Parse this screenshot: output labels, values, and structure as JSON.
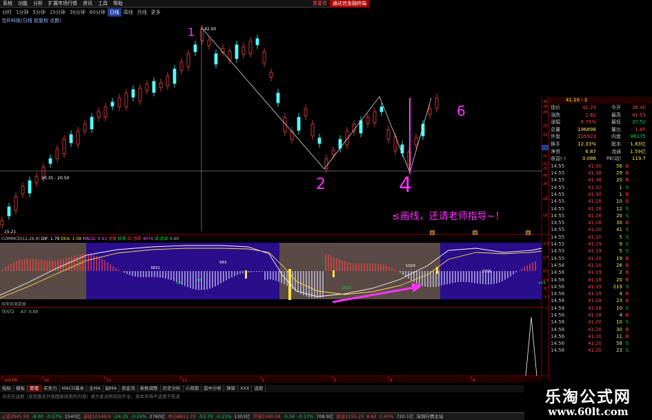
{
  "menu": {
    "items": [
      "系统",
      "功能",
      "分析",
      "扩展市场行情",
      "资讯",
      "工具",
      "帮助"
    ],
    "special": "重要资",
    "brand": "通达信金融终端"
  },
  "periods": {
    "items": [
      "分时",
      "1分钟",
      "5分钟",
      "15分钟",
      "30分钟",
      "60分钟",
      "日线",
      "周线",
      "月线",
      "更多"
    ],
    "active": "日线"
  },
  "stock": {
    "name": "当升科技(日线 前复权 点数)"
  },
  "main_chart": {
    "price_labels": {
      "top": "42.00",
      "mid": "20.35 - 20.50",
      "bottom": "15.21"
    },
    "right_axis": [
      "28.83",
      "28.60",
      "28.37",
      "23.61",
      "23.28",
      "22.46",
      "21.86",
      "21.32",
      "21.00",
      "20.65",
      "20.32",
      "19.55",
      "19.00"
    ],
    "axis_highlight": "22.46",
    "annotations": [
      "1",
      "2",
      "4",
      "6"
    ],
    "note": "≤画线，还请老师指导~！",
    "markers": [
      "跌",
      "涨",
      "跌"
    ]
  },
  "indicator": {
    "title": "COMMCD(12,26,9)",
    "values": [
      {
        "text": "DIF: 1.79",
        "color": "#ffffff"
      },
      {
        "text": "DEA: 1.58",
        "color": "#ffe24a"
      },
      {
        "text": "MACD: 0.41",
        "color": "#ff66ff"
      },
      {
        "text": "顶背",
        "color": "#ff4444"
      },
      {
        "text": "底背",
        "color": "#00d84a"
      },
      {
        "text": "红:顶部",
        "color": "#ff4444"
      },
      {
        "text": "4074",
        "color": "#ff66ff"
      },
      {
        "text": "绿:底部",
        "color": "#00d84a"
      },
      {
        "text": "0.00",
        "color": "#c0c0c0"
      }
    ],
    "labels": [
      "3831",
      "983",
      "285",
      "86",
      "2820",
      "1024",
      "2096",
      "434"
    ],
    "footer": "周期背离数据",
    "axis": [
      "2.00",
      "1.50",
      "0.50",
      "0.00",
      "-0.50",
      "-1.00"
    ]
  },
  "sub_indicator": {
    "title": "TEST2",
    "value": "A7: 0.00"
  },
  "dates": [
    "2015年",
    "10",
    "11",
    "12",
    "1",
    "2",
    "3",
    "4"
  ],
  "quote": {
    "header": "41.10 - 2",
    "rows": [
      {
        "c1": "现价",
        "c2": "41.29",
        "c3": "今开",
        "c4": "38.40",
        "cc2": "red",
        "cc4": "red"
      },
      {
        "c1": "涨跌",
        "c2": "2.61",
        "c3": "最高",
        "c4": "41.53",
        "cc2": "red",
        "cc4": "red"
      },
      {
        "c1": "涨幅",
        "c2": "6.76%",
        "c3": "最低",
        "c4": "37.52",
        "cc2": "red",
        "cc4": "green"
      },
      {
        "c1": "总量",
        "c2": "196898",
        "c3": "量比",
        "c4": "1.85",
        "cc2": "yellow",
        "cc4": "red"
      },
      {
        "c1": "外盘",
        "c2": "105923",
        "c3": "内盘",
        "c4": "86175",
        "cc2": "red",
        "cc4": "green"
      },
      {
        "c1": "换手",
        "c2": "12.33%",
        "c3": "股本",
        "c4": "1.83亿",
        "cc2": "yellow",
        "cc4": "yellow"
      },
      {
        "c1": "净资",
        "c2": "6.87",
        "c3": "流通",
        "c4": "1.59亿",
        "cc2": "yellow",
        "cc4": "yellow"
      },
      {
        "c1": "收益(-)",
        "c2": "0.086",
        "c3": "PE(动)",
        "c4": "119.7",
        "cc2": "yellow",
        "cc4": "yellow"
      }
    ],
    "ticks": [
      {
        "t": "14:55",
        "p": "41.30",
        "v": "56",
        "d": "B"
      },
      {
        "t": "14:55",
        "p": "41.38",
        "v": "29",
        "d": "B"
      },
      {
        "t": "14:55",
        "p": "41.38",
        "v": "20",
        "d": "B"
      },
      {
        "t": "14:55",
        "p": "41.32",
        "v": "1",
        "d": "S"
      },
      {
        "t": "14:55",
        "p": "41.30",
        "v": "1",
        "d": "B"
      },
      {
        "t": "14:55",
        "p": "41.28",
        "v": "10",
        "d": "B"
      },
      {
        "t": "14:55",
        "p": "41.26",
        "v": "12",
        "d": "S"
      },
      {
        "t": "14:55",
        "p": "41.28",
        "v": "20",
        "d": "S"
      },
      {
        "t": "14:55",
        "p": "41.28",
        "v": "30",
        "d": "B"
      },
      {
        "t": "14:55",
        "p": "41.20",
        "v": "41",
        "d": "S"
      },
      {
        "t": "14:55",
        "p": "41.20",
        "v": "5",
        "d": "S"
      },
      {
        "t": "14:55",
        "p": "41.19",
        "v": "9",
        "d": "S"
      },
      {
        "t": "14:55",
        "p": "41.19",
        "v": "5",
        "d": "S"
      },
      {
        "t": "14:55",
        "p": "41.20",
        "v": "19",
        "d": "B"
      },
      {
        "t": "14:56",
        "p": "41.20",
        "v": "26",
        "d": "B"
      },
      {
        "t": "14:56",
        "p": "41.19",
        "v": "2",
        "d": "B"
      },
      {
        "t": "14:56",
        "p": "41.18",
        "v": "20",
        "d": "B"
      },
      {
        "t": "14:56",
        "p": "41.19",
        "v": "219",
        "d": "S"
      },
      {
        "t": "14:56",
        "p": "41.19",
        "v": "4",
        "d": "B"
      },
      {
        "t": "14:56",
        "p": "41.18",
        "v": "23",
        "d": "B"
      },
      {
        "t": "14:56",
        "p": "41.18",
        "v": "10",
        "d": "S"
      },
      {
        "t": "14:56",
        "p": "41.18",
        "v": "4",
        "d": "B"
      },
      {
        "t": "14:56",
        "p": "41.20",
        "v": "10",
        "d": "S"
      },
      {
        "t": "14:56",
        "p": "41.20",
        "v": "30",
        "d": "B"
      },
      {
        "t": "14:56",
        "p": "41.20",
        "v": "11",
        "d": "B"
      },
      {
        "t": "14:56",
        "p": "41.20",
        "v": "58",
        "d": "S"
      },
      {
        "t": "14:56",
        "p": "41.20",
        "v": "23",
        "d": "S"
      }
    ]
  },
  "tabs": {
    "items": [
      "指标",
      "模板",
      "管理",
      "买卖力",
      "MACD基本",
      "主MA",
      "副MA",
      "资金流",
      "参数调整",
      "历史分析",
      "小周期",
      "盘中分析",
      "弹窗",
      "XXX",
      "选股"
    ],
    "active": "管理"
  },
  "infobar": {
    "items": [
      "点击任选框",
      "(该页面无外部国家政策的内容)",
      "请大家对照风险不全，资本市场不适用于投资"
    ]
  },
  "status": {
    "items": [
      {
        "text": "上证2945.59",
        "color": "#ff4444"
      },
      {
        "text": "-8.00",
        "color": "#00d84a"
      },
      {
        "text": "-0.27%",
        "color": "#00d84a"
      },
      {
        "text": "1540亿",
        "color": "#c0c0c0"
      },
      {
        "text": "深证10149.9",
        "color": "#ff4444"
      },
      {
        "text": "-24.25",
        "color": "#00d84a"
      },
      {
        "text": "-0.24%",
        "color": "#00d84a"
      },
      {
        "text": "2760亿",
        "color": "#c0c0c0"
      },
      {
        "text": "中小8611.70",
        "color": "#ff4444"
      },
      {
        "text": "-53.79",
        "color": "#00d84a"
      },
      {
        "text": "-0.21%",
        "color": "#00d84a"
      },
      {
        "text": "1303亿",
        "color": "#c0c0c0"
      },
      {
        "text": "沪深3160.58",
        "color": "#ff4444"
      },
      {
        "text": "-5.34",
        "color": "#00d84a"
      },
      {
        "text": "-0.17%",
        "color": "#00d84a"
      },
      {
        "text": "708.9亿",
        "color": "#c0c0c0"
      },
      {
        "text": "创业2155.23",
        "color": "#ff4444"
      },
      {
        "text": "8.62",
        "color": "#ff4444"
      },
      {
        "text": "0.40%",
        "color": "#ff4444"
      },
      {
        "text": "720.1亿",
        "color": "#c0c0c0"
      },
      {
        "text": "深圳行情主站",
        "color": "#c0c0c0"
      }
    ]
  },
  "banner": {
    "title": "乐淘公式网",
    "url": "www.60lt.com"
  }
}
